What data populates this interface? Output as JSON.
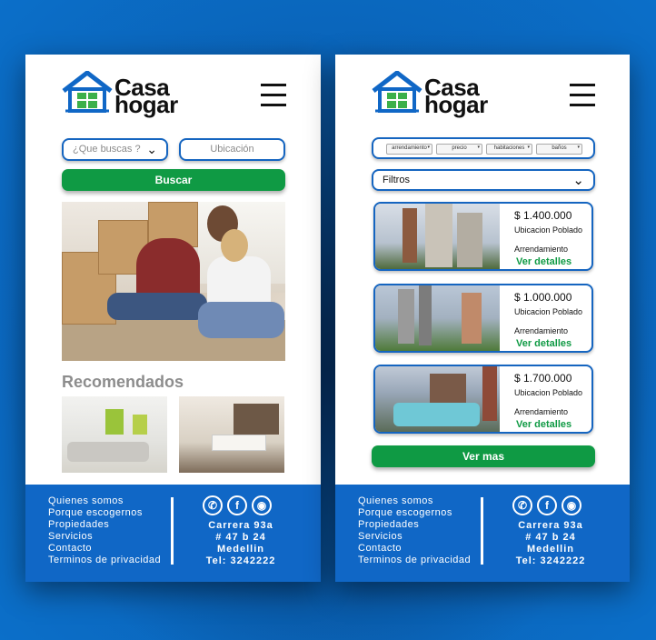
{
  "brand": {
    "line1": "Casa",
    "line2": "hogar",
    "color_accent": "#1067c6",
    "color_green": "#0f9a44"
  },
  "left": {
    "search_select_label": "¿Que buscas ?",
    "location_placeholder": "Ubicación",
    "search_button": "Buscar",
    "section_title": "Recomendados"
  },
  "right": {
    "filter_chips": [
      "arrendamiento",
      "precio",
      "habitaciones",
      "baños"
    ],
    "filters_label": "Filtros",
    "listings": [
      {
        "price": "$ 1.400.000",
        "location": "Ubicacion Poblado",
        "type": "Arrendamiento",
        "details": "Ver detalles"
      },
      {
        "price": "$ 1.000.000",
        "location": "Ubicacion Poblado",
        "type": "Arrendamiento",
        "details": "Ver detalles"
      },
      {
        "price": "$ 1.700.000",
        "location": "Ubicacion Poblado",
        "type": "Arrendamiento",
        "details": "Ver detalles"
      }
    ],
    "more_button": "Ver mas"
  },
  "footer": {
    "links": [
      "Quienes somos",
      "Porque escogernos",
      "Propiedades",
      "Servicios",
      "Contacto",
      "Terminos de privacidad"
    ],
    "social_icons": [
      "whatsapp-icon",
      "facebook-icon",
      "instagram-icon"
    ],
    "address_line1": "Carrera 93a",
    "address_line2": "# 47 b 24",
    "city": "Medellin",
    "phone": "Tel: 3242222"
  }
}
